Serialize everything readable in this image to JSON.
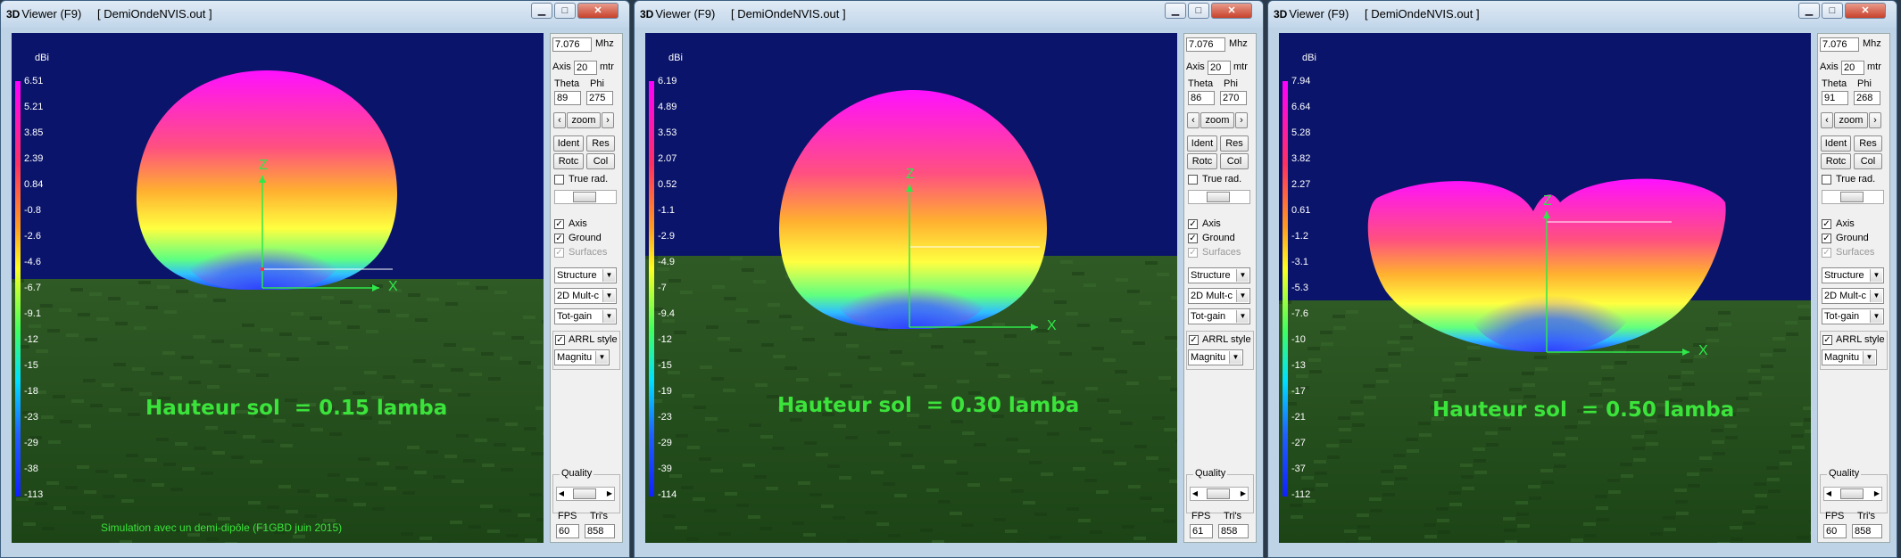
{
  "colors": {
    "sky": "#0a146a",
    "ground": "#244f1c",
    "caption": "#3be33b",
    "title_bg": "#c9dbee"
  },
  "windows": [
    {
      "title_app": "Viewer (F9)",
      "title_prefix": "3D",
      "title_file": "[  DemiOndeNVIS.out  ]",
      "scale_unit": "dBi",
      "scale": [
        "6.51",
        "5.21",
        "3.85",
        "2.39",
        "0.84",
        "-0.8",
        "-2.6",
        "-4.6",
        "-6.7",
        "-9.1",
        "-12",
        "-15",
        "-18",
        "-23",
        "-29",
        "-38",
        "-113"
      ],
      "freq": "7.076",
      "freq_unit": "Mhz",
      "axis_label": "Axis",
      "axis": "20",
      "axis_unit": "mtr",
      "theta_label": "Theta",
      "phi_label": "Phi",
      "theta": "89",
      "phi": "275",
      "zoom_label": "zoom",
      "ident": "Ident",
      "res": "Res",
      "rotc": "Rotc",
      "col": "Col",
      "true_rad": "True rad.",
      "axis_cb": "Axis",
      "ground_cb": "Ground",
      "surfaces_cb": "Surfaces",
      "structure": "Structure",
      "mult": "2D Mult-c",
      "gain": "Tot-gain",
      "arrl": "ARRL style",
      "magnitude": "Magnitu",
      "quality": "Quality",
      "fps_label": "FPS",
      "tris_label": "Tri's",
      "fps": "60",
      "tris": "858",
      "x_label": "X",
      "z_label": "Z",
      "caption": "Hauteur sol  = 0.15 lamba",
      "footer": "Simulation avec un demi-dipôle (F1GBD juin 2015)",
      "has_footer": true,
      "shape": "ball15"
    },
    {
      "title_app": "Viewer (F9)",
      "title_prefix": "3D",
      "title_file": "[  DemiOndeNVIS.out  ]",
      "scale_unit": "dBi",
      "scale": [
        "6.19",
        "4.89",
        "3.53",
        "2.07",
        "0.52",
        "-1.1",
        "-2.9",
        "-4.9",
        "-7",
        "-9.4",
        "-12",
        "-15",
        "-19",
        "-23",
        "-29",
        "-39",
        "-114"
      ],
      "freq": "7.076",
      "freq_unit": "Mhz",
      "axis_label": "Axis",
      "axis": "20",
      "axis_unit": "mtr",
      "theta_label": "Theta",
      "phi_label": "Phi",
      "theta": "86",
      "phi": "270",
      "zoom_label": "zoom",
      "ident": "Ident",
      "res": "Res",
      "rotc": "Rotc",
      "col": "Col",
      "true_rad": "True rad.",
      "axis_cb": "Axis",
      "ground_cb": "Ground",
      "surfaces_cb": "Surfaces",
      "structure": "Structure",
      "mult": "2D Mult-c",
      "gain": "Tot-gain",
      "arrl": "ARRL style",
      "magnitude": "Magnitu",
      "quality": "Quality",
      "fps_label": "FPS",
      "tris_label": "Tri's",
      "fps": "61",
      "tris": "858",
      "x_label": "X",
      "z_label": "Z",
      "caption": "Hauteur sol  = 0.30 lamba",
      "footer": "",
      "has_footer": false,
      "shape": "ball30"
    },
    {
      "title_app": "Viewer (F9)",
      "title_prefix": "3D",
      "title_file": "[  DemiOndeNVIS.out  ]",
      "scale_unit": "dBi",
      "scale": [
        "7.94",
        "6.64",
        "5.28",
        "3.82",
        "2.27",
        "0.61",
        "-1.2",
        "-3.1",
        "-5.3",
        "-7.6",
        "-10",
        "-13",
        "-17",
        "-21",
        "-27",
        "-37",
        "-112"
      ],
      "freq": "7.076",
      "freq_unit": "Mhz",
      "axis_label": "Axis",
      "axis": "20",
      "axis_unit": "mtr",
      "theta_label": "Theta",
      "phi_label": "Phi",
      "theta": "91",
      "phi": "268",
      "zoom_label": "zoom",
      "ident": "Ident",
      "res": "Res",
      "rotc": "Rotc",
      "col": "Col",
      "true_rad": "True rad.",
      "axis_cb": "Axis",
      "ground_cb": "Ground",
      "surfaces_cb": "Surfaces",
      "structure": "Structure",
      "mult": "2D Mult-c",
      "gain": "Tot-gain",
      "arrl": "ARRL style",
      "magnitude": "Magnitu",
      "quality": "Quality",
      "fps_label": "FPS",
      "tris_label": "Tri's",
      "fps": "60",
      "tris": "858",
      "x_label": "X",
      "z_label": "Z",
      "caption": "Hauteur sol  = 0.50 lamba",
      "footer": "",
      "has_footer": false,
      "shape": "butterfly"
    }
  ]
}
